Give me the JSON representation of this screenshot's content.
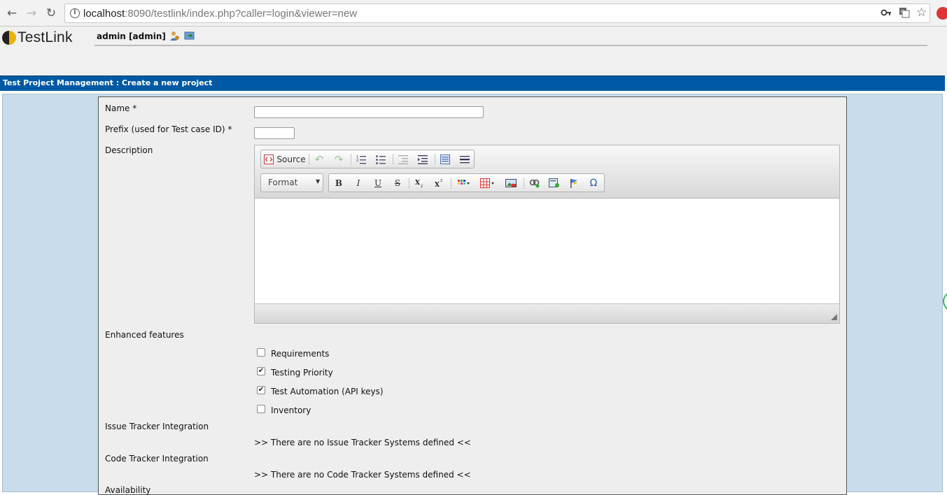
{
  "browser": {
    "url_host": "localhost",
    "url_rest": ":8090/testlink/index.php?caller=login&viewer=new",
    "icons": [
      "back-arrow-icon",
      "forward-arrow-icon",
      "reload-icon",
      "info-icon",
      "key-icon",
      "translate-icon",
      "star-icon"
    ]
  },
  "header": {
    "logo_text": "TestLink",
    "user": "admin [admin]"
  },
  "title_bar": "Test Project Management : Create a new project",
  "form": {
    "name_label": "Name *",
    "name_value": "",
    "prefix_label": "Prefix (used for Test case ID) *",
    "prefix_value": "",
    "description_label": "Description",
    "editor": {
      "source_label": "Source",
      "format_label": "Format",
      "bold": "B",
      "italic": "I",
      "underline": "U",
      "strike": "S",
      "special_char": "Ω"
    },
    "enhanced_label": "Enhanced features",
    "features": [
      {
        "label": "Requirements",
        "checked": false
      },
      {
        "label": "Testing Priority",
        "checked": true
      },
      {
        "label": "Test Automation (API keys)",
        "checked": true
      },
      {
        "label": "Inventory",
        "checked": false
      }
    ],
    "issue_tracker_label": "Issue Tracker Integration",
    "issue_tracker_msg": ">> There are no Issue Tracker Systems defined <<",
    "code_tracker_label": "Code Tracker Integration",
    "code_tracker_msg": ">> There are no Code Tracker Systems defined <<",
    "availability_label": "Availability"
  },
  "colors": {
    "title_bar": "#0059a4",
    "workarea": "#c9dcec",
    "panel": "#eeeeee"
  }
}
